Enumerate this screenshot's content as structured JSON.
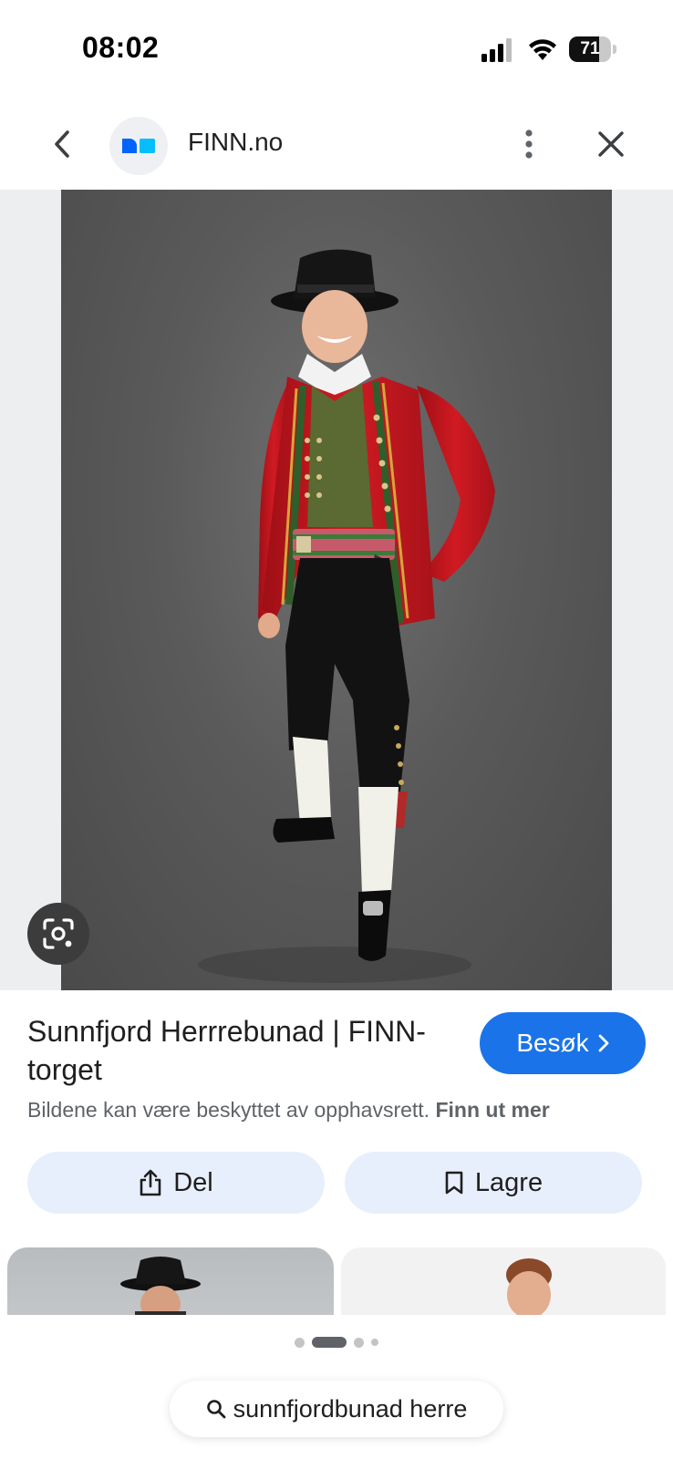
{
  "status_bar": {
    "time": "08:02",
    "battery_level": "71",
    "battery_fraction": 0.71
  },
  "header": {
    "site_name": "FINN.no",
    "icons": [
      "back-arrow-icon",
      "finn-logo",
      "more-vertical-icon",
      "close-icon"
    ]
  },
  "result": {
    "title": "Sunnfjord Herrrebunad | FINN-torget",
    "visit_label": "Besøk",
    "copyright_text": "Bildene kan være beskyttet av opphavsrett.",
    "learn_more": "Finn ut mer"
  },
  "actions": {
    "share_label": "Del",
    "save_label": "Lagre"
  },
  "search": {
    "query": "sunnfjordbunad herre"
  },
  "pagination": {
    "active_index": 1,
    "count": 4
  },
  "colors": {
    "accent": "#1a73e8",
    "action_bg": "#e8effc",
    "jacket_red": "#c0141c",
    "vest_green": "#5a6a32"
  }
}
